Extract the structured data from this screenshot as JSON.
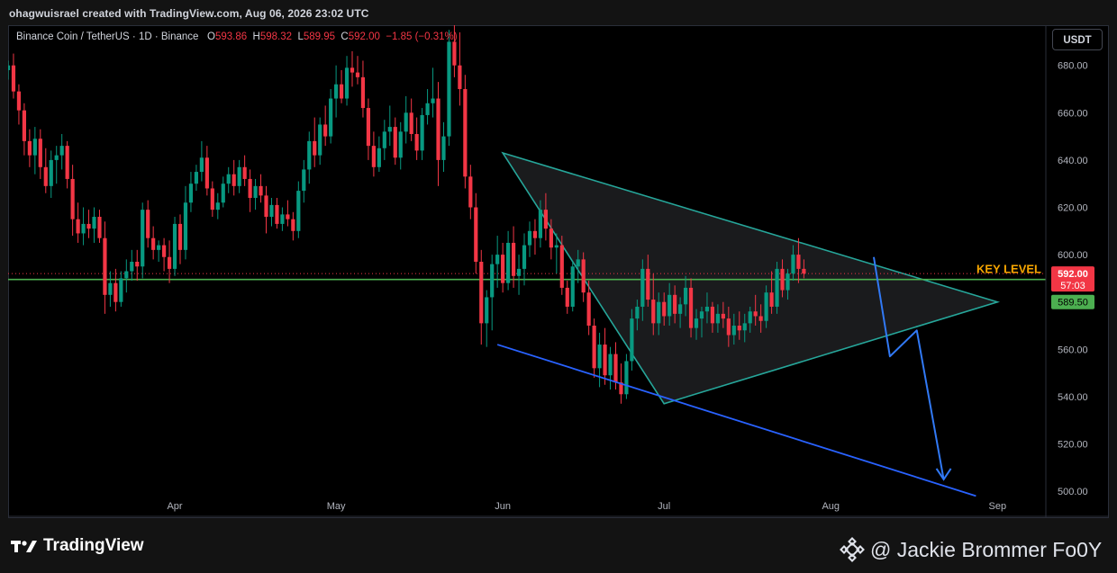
{
  "header": {
    "attribution": "ohagwuisrael created with TradingView.com, Aug 06, 2026 23:02 UTC"
  },
  "legend": {
    "symbol": "Binance Coin / TetherUS · 1D · Binance",
    "open_label": "O",
    "open": "593.86",
    "high_label": "H",
    "high": "598.32",
    "low_label": "L",
    "low": "589.95",
    "close_label": "C",
    "close": "592.00",
    "change": "−1.85 (−0.31%)"
  },
  "currency_button": "USDT",
  "footer": {
    "logo_text": "TradingView",
    "watermark": "@ Jackie Brommer Fo0Y"
  },
  "colors": {
    "up": "#089981",
    "down": "#f23645",
    "pattern_line": "#26a69a",
    "trend_line": "#2962ff",
    "key_level": "#4caf50",
    "key_label": "#f7a600"
  },
  "chart_data": {
    "type": "candlestick",
    "y_ticks": [
      "680.00",
      "660.00",
      "640.00",
      "620.00",
      "600.00",
      "560.00",
      "540.00",
      "520.00",
      "500.00"
    ],
    "ylim": [
      497,
      697
    ],
    "x_ticks": [
      {
        "label": "Apr",
        "date": "2026-04-01"
      },
      {
        "label": "May",
        "date": "2026-05-01"
      },
      {
        "label": "Jun",
        "date": "2026-06-01"
      },
      {
        "label": "Jul",
        "date": "2026-07-01"
      },
      {
        "label": "Aug",
        "date": "2026-08-01"
      },
      {
        "label": "Sep",
        "date": "2026-09-01"
      }
    ],
    "x_range": [
      "2026-03-01",
      "2026-09-10"
    ],
    "price_labels": {
      "last_price": "592.00",
      "countdown": "57:03",
      "key_level_price": "589.50"
    },
    "key_level": {
      "label": "KEY LEVEL",
      "price": 589.5
    },
    "annotations": {
      "triangle": [
        {
          "date": "2026-06-01",
          "price": 643
        },
        {
          "date": "2026-09-01",
          "price": 580
        },
        {
          "date": "2026-07-01",
          "price": 537
        }
      ],
      "lower_trendline": [
        {
          "date": "2026-05-31",
          "price": 562
        },
        {
          "date": "2026-08-28",
          "price": 498
        }
      ],
      "projection_arrow": [
        {
          "date": "2026-08-09",
          "price": 599
        },
        {
          "date": "2026-08-12",
          "price": 557
        },
        {
          "date": "2026-08-17",
          "price": 568
        },
        {
          "date": "2026-08-22",
          "price": 505
        }
      ]
    },
    "candle_start_date": "2026-03-01",
    "candles": [
      [
        678,
        682,
        674,
        680
      ],
      [
        680,
        685,
        666,
        669
      ],
      [
        669,
        672,
        655,
        661
      ],
      [
        661,
        664,
        642,
        648
      ],
      [
        648,
        653,
        637,
        642
      ],
      [
        642,
        654,
        634,
        649
      ],
      [
        649,
        653,
        632,
        637
      ],
      [
        637,
        645,
        626,
        629
      ],
      [
        629,
        644,
        624,
        640
      ],
      [
        640,
        646,
        630,
        642
      ],
      [
        642,
        651,
        636,
        646
      ],
      [
        646,
        648,
        628,
        632
      ],
      [
        632,
        638,
        608,
        615
      ],
      [
        615,
        622,
        605,
        609
      ],
      [
        609,
        620,
        604,
        613
      ],
      [
        613,
        619,
        607,
        611
      ],
      [
        611,
        620,
        605,
        616
      ],
      [
        616,
        619,
        605,
        607
      ],
      [
        607,
        614,
        575,
        583
      ],
      [
        583,
        593,
        578,
        588
      ],
      [
        588,
        594,
        576,
        580
      ],
      [
        580,
        593,
        578,
        590
      ],
      [
        590,
        598,
        584,
        593
      ],
      [
        593,
        602,
        589,
        597
      ],
      [
        597,
        602,
        589,
        595
      ],
      [
        595,
        622,
        590,
        619
      ],
      [
        619,
        623,
        603,
        607
      ],
      [
        607,
        612,
        598,
        602
      ],
      [
        602,
        606,
        597,
        604
      ],
      [
        604,
        607,
        593,
        599
      ],
      [
        599,
        606,
        588,
        594
      ],
      [
        594,
        616,
        591,
        613
      ],
      [
        613,
        617,
        596,
        602
      ],
      [
        602,
        629,
        598,
        622
      ],
      [
        622,
        635,
        618,
        630
      ],
      [
        630,
        638,
        627,
        635
      ],
      [
        635,
        648,
        631,
        641
      ],
      [
        641,
        646,
        625,
        628
      ],
      [
        628,
        631,
        616,
        619
      ],
      [
        619,
        626,
        615,
        622
      ],
      [
        622,
        633,
        620,
        630
      ],
      [
        630,
        637,
        626,
        634
      ],
      [
        634,
        640,
        625,
        629
      ],
      [
        629,
        640,
        626,
        637
      ],
      [
        637,
        642,
        629,
        632
      ],
      [
        632,
        636,
        618,
        624
      ],
      [
        624,
        632,
        619,
        629
      ],
      [
        629,
        634,
        622,
        625
      ],
      [
        625,
        629,
        609,
        616
      ],
      [
        616,
        624,
        612,
        621
      ],
      [
        621,
        624,
        611,
        613
      ],
      [
        613,
        620,
        610,
        617
      ],
      [
        617,
        623,
        612,
        615
      ],
      [
        615,
        618,
        606,
        610
      ],
      [
        610,
        631,
        607,
        627
      ],
      [
        627,
        640,
        622,
        636
      ],
      [
        636,
        652,
        630,
        648
      ],
      [
        648,
        658,
        637,
        642
      ],
      [
        642,
        658,
        638,
        655
      ],
      [
        655,
        663,
        646,
        650
      ],
      [
        650,
        670,
        647,
        666
      ],
      [
        666,
        680,
        658,
        672
      ],
      [
        672,
        678,
        664,
        666
      ],
      [
        666,
        684,
        663,
        679
      ],
      [
        679,
        686,
        671,
        677
      ],
      [
        677,
        684,
        672,
        675
      ],
      [
        675,
        682,
        658,
        662
      ],
      [
        662,
        666,
        640,
        646
      ],
      [
        646,
        652,
        633,
        637
      ],
      [
        637,
        650,
        635,
        645
      ],
      [
        645,
        657,
        640,
        652
      ],
      [
        652,
        663,
        646,
        654
      ],
      [
        654,
        658,
        638,
        641
      ],
      [
        641,
        656,
        636,
        652
      ],
      [
        652,
        667,
        647,
        660
      ],
      [
        660,
        666,
        648,
        651
      ],
      [
        651,
        658,
        640,
        644
      ],
      [
        644,
        662,
        640,
        659
      ],
      [
        659,
        670,
        655,
        664
      ],
      [
        664,
        679,
        658,
        666
      ],
      [
        666,
        673,
        629,
        640
      ],
      [
        640,
        656,
        635,
        650
      ],
      [
        650,
        695,
        646,
        690
      ],
      [
        690,
        704,
        675,
        680
      ],
      [
        680,
        694,
        663,
        670
      ],
      [
        670,
        676,
        628,
        633
      ],
      [
        633,
        638,
        615,
        620
      ],
      [
        620,
        626,
        592,
        597
      ],
      [
        597,
        602,
        562,
        571
      ],
      [
        571,
        585,
        561,
        582
      ],
      [
        582,
        600,
        568,
        596
      ],
      [
        596,
        608,
        586,
        600
      ],
      [
        600,
        605,
        584,
        588
      ],
      [
        588,
        610,
        585,
        605
      ],
      [
        605,
        612,
        586,
        591
      ],
      [
        591,
        600,
        583,
        594
      ],
      [
        594,
        609,
        587,
        604
      ],
      [
        604,
        614,
        599,
        610
      ],
      [
        610,
        615,
        600,
        607
      ],
      [
        607,
        623,
        603,
        619
      ],
      [
        619,
        626,
        606,
        611
      ],
      [
        611,
        615,
        598,
        603
      ],
      [
        603,
        609,
        592,
        604
      ],
      [
        604,
        608,
        583,
        586
      ],
      [
        586,
        589,
        575,
        578
      ],
      [
        578,
        597,
        576,
        595
      ],
      [
        595,
        602,
        588,
        598
      ],
      [
        598,
        601,
        580,
        584
      ],
      [
        584,
        589,
        566,
        570
      ],
      [
        570,
        573,
        548,
        552
      ],
      [
        552,
        567,
        544,
        562
      ],
      [
        562,
        569,
        545,
        549
      ],
      [
        549,
        561,
        543,
        558
      ],
      [
        558,
        563,
        543,
        546
      ],
      [
        546,
        554,
        537,
        541
      ],
      [
        541,
        558,
        539,
        555
      ],
      [
        555,
        577,
        551,
        573
      ],
      [
        573,
        581,
        568,
        578
      ],
      [
        578,
        598,
        572,
        594
      ],
      [
        594,
        600,
        578,
        581
      ],
      [
        581,
        592,
        566,
        571
      ],
      [
        571,
        584,
        566,
        580
      ],
      [
        580,
        584,
        570,
        574
      ],
      [
        574,
        588,
        570,
        583
      ],
      [
        583,
        587,
        571,
        575
      ],
      [
        575,
        582,
        569,
        579
      ],
      [
        579,
        591,
        574,
        586
      ],
      [
        586,
        590,
        565,
        569
      ],
      [
        569,
        577,
        564,
        573
      ],
      [
        573,
        578,
        565,
        576
      ],
      [
        576,
        584,
        571,
        578
      ],
      [
        578,
        580,
        567,
        571
      ],
      [
        571,
        579,
        567,
        575
      ],
      [
        575,
        580,
        569,
        573
      ],
      [
        573,
        578,
        561,
        566
      ],
      [
        566,
        575,
        562,
        570
      ],
      [
        570,
        576,
        564,
        568
      ],
      [
        568,
        575,
        563,
        571
      ],
      [
        571,
        578,
        567,
        576
      ],
      [
        576,
        583,
        570,
        574
      ],
      [
        574,
        579,
        567,
        572
      ],
      [
        572,
        587,
        569,
        584
      ],
      [
        584,
        593,
        575,
        578
      ],
      [
        578,
        597,
        575,
        594
      ],
      [
        594,
        598,
        582,
        585
      ],
      [
        585,
        594,
        581,
        592
      ],
      [
        592,
        604,
        589,
        600
      ],
      [
        600,
        607,
        588,
        594
      ],
      [
        594,
        598,
        590,
        592
      ]
    ]
  }
}
